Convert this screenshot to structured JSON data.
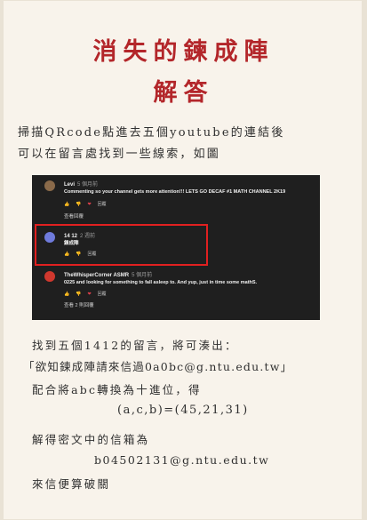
{
  "title_line1": "消失的鍊成陣",
  "title_line2": "解答",
  "intro_line1": "掃描QRcode點進去五個youtube的連結後",
  "intro_line2": "可以在留言處找到一些線索，如圖",
  "screenshot": {
    "comments": [
      {
        "author": "Levi",
        "time": "5 個月前",
        "text": "Commenting so your channel gets more attention!!! LETS GO DECAF #1 MATH CHANNEL 2K19",
        "reply_label": "回覆",
        "view_replies": "查看回覆",
        "avatar_color": "#8a6a4a"
      },
      {
        "author": "14 12",
        "time": "2 週前",
        "text": "鍊成陣",
        "reply_label": "回覆",
        "avatar_color": "#6f7bdc"
      },
      {
        "author": "TheWhisperCorner ASMR",
        "time": "5 個月前",
        "text": "0225 and looking for something to fall asleep to. And yup, just in time some mathS.",
        "reply_label": "回覆",
        "view_replies": "查看 2 則回覆",
        "avatar_color": "#d0382e"
      }
    ]
  },
  "line3": "找到五個1412的留言，將可湊出：",
  "line4": "「欲知鍊成陣請來信過0a0bc@g.ntu.edu.tw」",
  "line5": "配合將abc轉換為十進位，得",
  "line6": "(a,c,b)=(45,21,31)",
  "line7": "解得密文中的信箱為",
  "line8": "b04502131@g.ntu.edu.tw",
  "line9": "來信便算破關"
}
